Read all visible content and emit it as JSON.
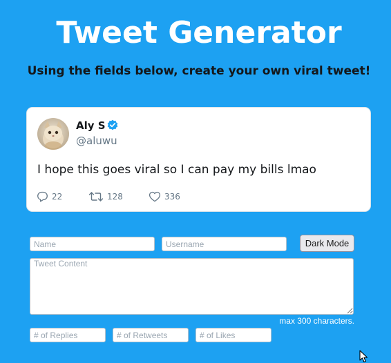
{
  "header": {
    "title": "Tweet Generator",
    "subtitle": "Using the fields below, create your own viral tweet!"
  },
  "tweet": {
    "display_name": "Aly S",
    "handle": "@aluwu",
    "verified": true,
    "text": "I hope this goes viral so I can pay my bills lmao",
    "replies": "22",
    "retweets": "128",
    "likes": "336"
  },
  "form": {
    "name_placeholder": "Name",
    "username_placeholder": "Username",
    "dark_mode_label": "Dark Mode",
    "content_placeholder": "Tweet Content",
    "max_chars_note": "max 300 characters.",
    "replies_placeholder": "# of Replies",
    "retweets_placeholder": "# of Retweets",
    "likes_placeholder": "# of Likes"
  },
  "colors": {
    "background": "#1da1f2",
    "verified": "#1da1f2",
    "card": "#ffffff"
  },
  "icons": {
    "reply": "reply-icon",
    "retweet": "retweet-icon",
    "like": "heart-icon",
    "verified": "verified-badge-icon",
    "cursor": "mouse-pointer-icon"
  }
}
